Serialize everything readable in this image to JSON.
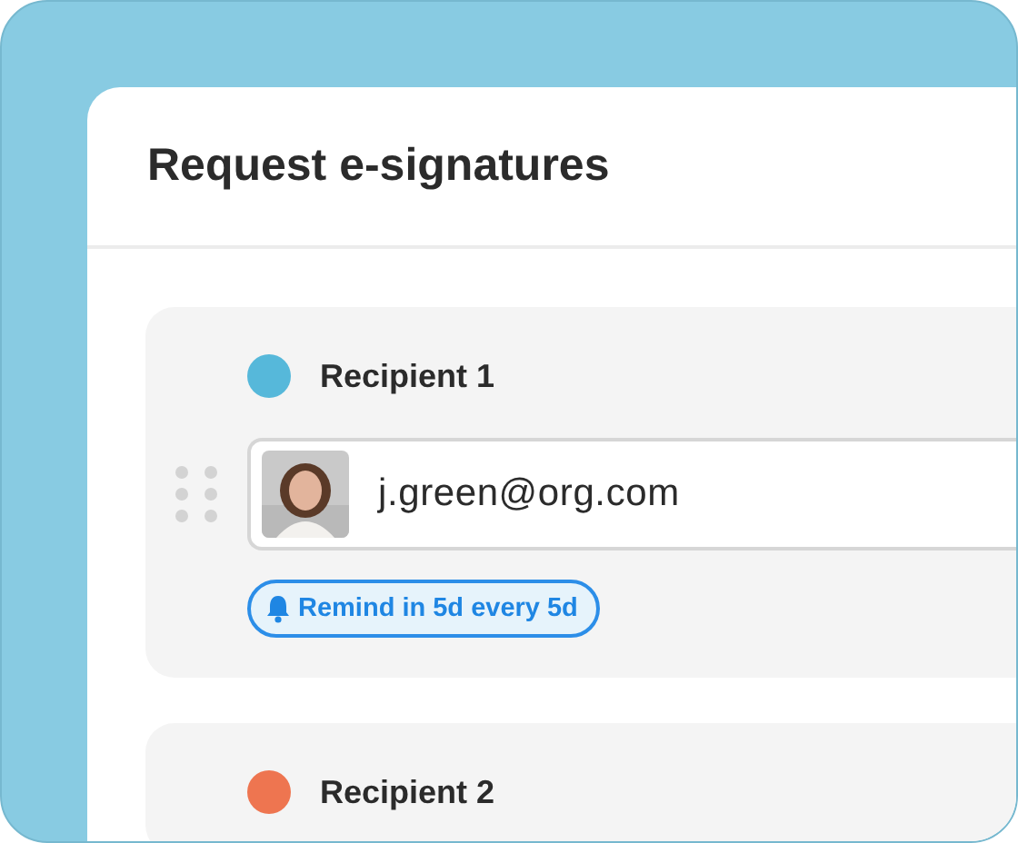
{
  "dialog": {
    "title": "Request e-signatures"
  },
  "recipients": [
    {
      "label": "Recipient 1",
      "color": "#56b8da",
      "email": "j.green@org.com",
      "reminder": "Remind in 5d every 5d"
    },
    {
      "label": "Recipient 2",
      "color": "#ee7550"
    }
  ]
}
